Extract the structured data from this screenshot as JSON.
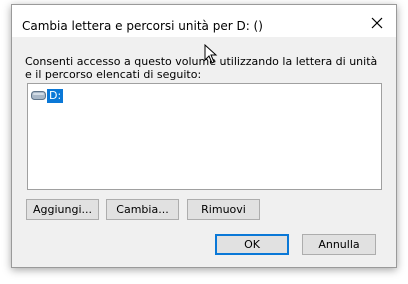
{
  "dialog": {
    "title": "Cambia lettera e percorsi unità per D: ()",
    "close_icon": "close-icon",
    "description": "Consenti accesso a questo volume utilizzando la lettera di unità e il percorso elencati di seguito:",
    "list": {
      "items": [
        {
          "icon": "drive-icon",
          "label": "D:",
          "selected": true
        }
      ]
    },
    "buttons": {
      "add": "Aggiungi...",
      "change": "Cambia...",
      "remove": "Rimuovi",
      "ok": "OK",
      "cancel": "Annulla"
    },
    "colors": {
      "selection": "#0a78d7",
      "dialog_bg": "#f0f0f0",
      "button_bg": "#e1e1e1"
    }
  }
}
